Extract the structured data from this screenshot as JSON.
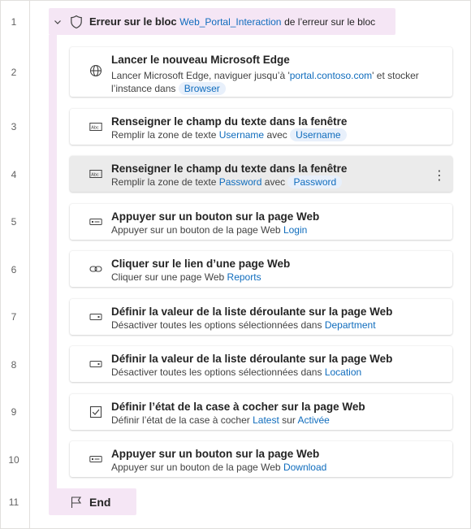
{
  "line_numbers": [
    "1",
    "2",
    "3",
    "4",
    "5",
    "6",
    "7",
    "8",
    "9",
    "10",
    "11"
  ],
  "block": {
    "title": "Erreur sur le bloc",
    "variable": "Web_Portal_Interaction",
    "suffix": "de l’erreur sur le bloc"
  },
  "end_label": "End",
  "actions": [
    {
      "title": "Lancer le nouveau Microsoft Edge",
      "sub_text_1": "Lancer Microsoft Edge, naviguer jusqu’à '",
      "sub_link": "portal.contoso.com",
      "sub_text_2": "' et stocker",
      "sub_line2_text": "l’instance dans",
      "sub_line2_pill": "Browser"
    },
    {
      "title": "Renseigner le champ du texte dans la fenêtre",
      "sub_text": "Remplir la zone de texte",
      "sub_link": "Username",
      "sub_mid": "avec",
      "sub_pill": "Username"
    },
    {
      "title": "Renseigner le champ du texte dans la fenêtre",
      "sub_text": "Remplir la zone de texte",
      "sub_link": "Password",
      "sub_mid": "avec",
      "sub_pill": "Password",
      "more": "⋮"
    },
    {
      "title": "Appuyer sur un bouton sur la page Web",
      "sub_text": "Appuyer sur un bouton de la page Web",
      "sub_link": "Login"
    },
    {
      "title": "Cliquer sur le lien d’une page Web",
      "sub_text": "Cliquer sur une page Web",
      "sub_link": "Reports"
    },
    {
      "title": "Définir la valeur de la liste déroulante sur la page Web",
      "sub_text": "Désactiver toutes les options sélectionnées dans",
      "sub_link": "Department"
    },
    {
      "title": "Définir la valeur de la liste déroulante sur la page Web",
      "sub_text": "Désactiver toutes les options sélectionnées dans",
      "sub_link": "Location"
    },
    {
      "title": "Définir l’état de la case à cocher sur la page Web",
      "sub_text": "Définir l’état de la case à cocher",
      "sub_link": "Latest",
      "sub_mid": "sur",
      "sub_link2": "Activée"
    },
    {
      "title": "Appuyer sur un bouton sur la page Web",
      "sub_text": "Appuyer sur un bouton de la page Web",
      "sub_link": "Download"
    }
  ],
  "icons": {
    "header_chevron": "chevron-down-icon",
    "header_shield": "shield-icon",
    "end_flag": "flag-icon",
    "a1": "globe-icon",
    "a2": "textbox-icon",
    "a3": "textbox-icon",
    "a4": "button-icon",
    "a5": "link-icon",
    "a6": "dropdown-icon",
    "a7": "dropdown-icon",
    "a8": "checkbox-icon",
    "a9": "button-icon"
  },
  "colors": {
    "block_bg": "#f5e6f5",
    "link": "#0f6cbd",
    "pill_bg": "#e8f0fb",
    "selected_bg": "#ebebeb"
  }
}
